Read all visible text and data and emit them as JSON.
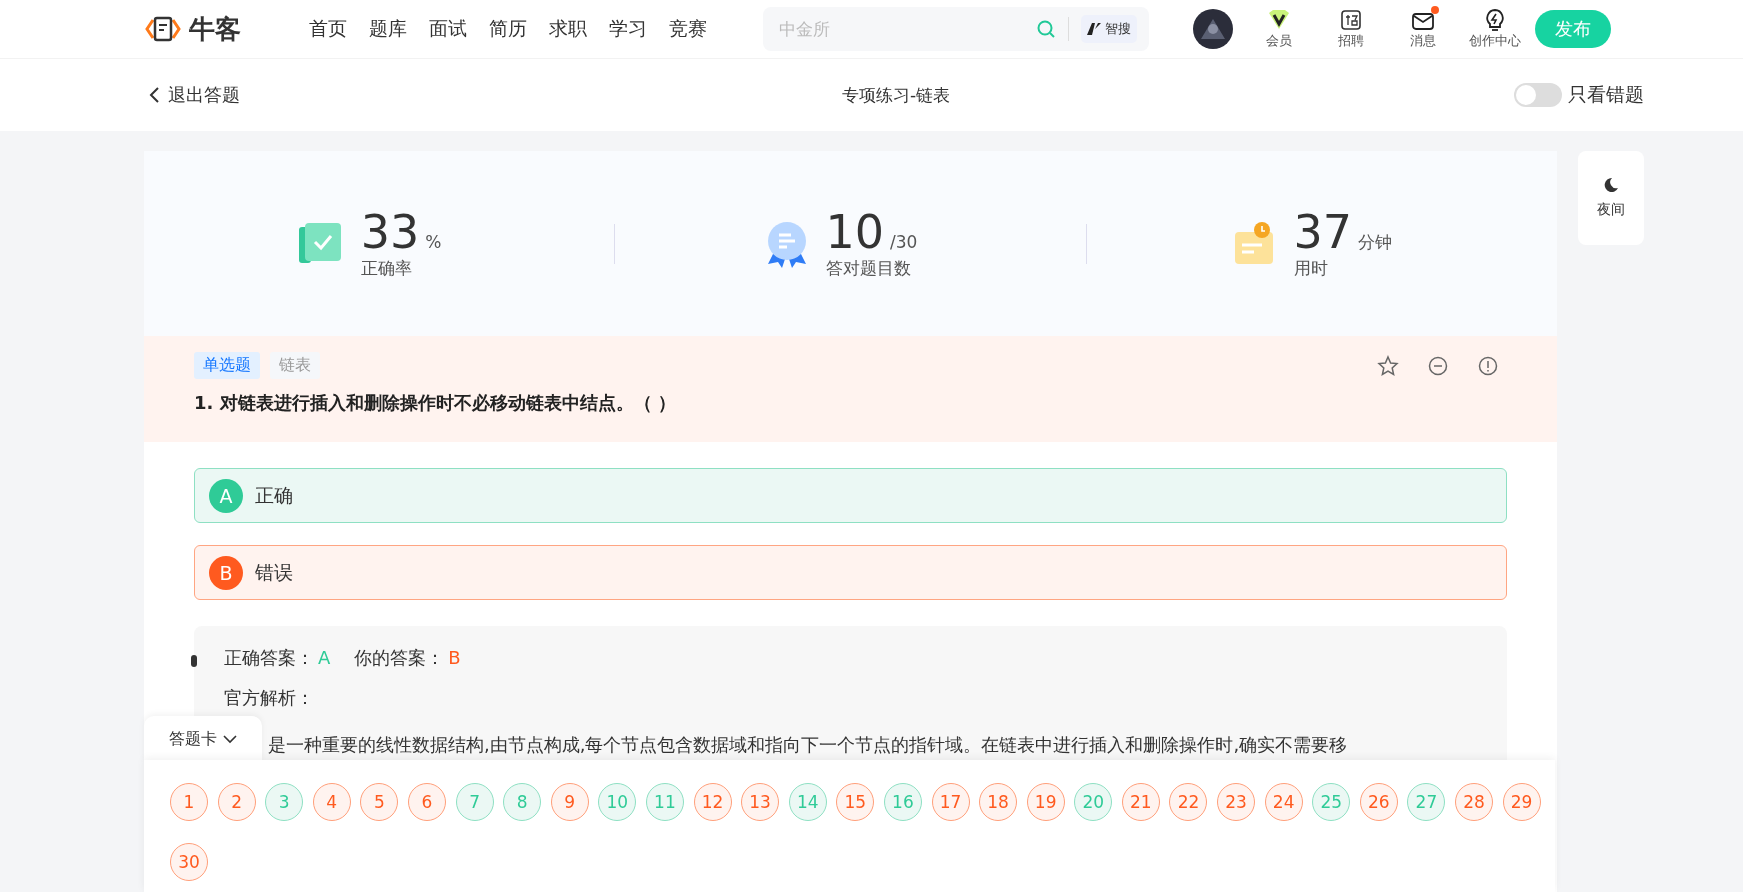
{
  "header": {
    "logo_text": "牛客",
    "nav": [
      "首页",
      "题库",
      "面试",
      "简历",
      "求职",
      "学习",
      "竞赛"
    ],
    "search": {
      "placeholder": "中金所",
      "ai_label": "智搜"
    },
    "shortcuts": [
      {
        "kind": "vip",
        "label": "会员",
        "badge": false
      },
      {
        "kind": "jobs",
        "label": "招聘",
        "badge": false
      },
      {
        "kind": "mail",
        "label": "消息",
        "badge": true
      },
      {
        "kind": "bulb",
        "label": "创作中心",
        "badge": false
      }
    ],
    "publish": "发布"
  },
  "subheader": {
    "back": "退出答题",
    "title": "专项练习-链表",
    "toggle": {
      "label": "只看错题",
      "on": false
    }
  },
  "stats": [
    {
      "kind": "accuracy",
      "value": "33",
      "unit": "%",
      "label": "正确率"
    },
    {
      "kind": "count",
      "value": "10",
      "unit": "/30",
      "label": "答对题目数"
    },
    {
      "kind": "time",
      "value": "37",
      "unit": "分钟",
      "label": "用时"
    }
  ],
  "night_mode": "夜间",
  "question": {
    "tags": [
      {
        "label": "单选题",
        "kind": "type"
      },
      {
        "label": "链表",
        "kind": "topic"
      }
    ],
    "text": "1. 对链表进行插入和删除操作时不必移动链表中结点。（  ）",
    "options": [
      {
        "letter": "A",
        "text": "正确",
        "is_answer": true,
        "selected": false
      },
      {
        "letter": "B",
        "text": "错误",
        "is_answer": false,
        "selected": true
      }
    ]
  },
  "analysis": {
    "correct_label": "正确答案：",
    "correct": "A",
    "yours_label": "你的答案：",
    "yours": "B",
    "heading": "官方解析：",
    "text": "是一种重要的线性数据结构,由节点构成,每个节点包含数据域和指向下一个节点的指针域。在链表中进行插入和删除操作时,确实不需要移"
  },
  "answer_card": {
    "title": "答题卡",
    "items": [
      {
        "n": "1",
        "correct": false
      },
      {
        "n": "2",
        "correct": false
      },
      {
        "n": "3",
        "correct": true
      },
      {
        "n": "4",
        "correct": false
      },
      {
        "n": "5",
        "correct": false
      },
      {
        "n": "6",
        "correct": false
      },
      {
        "n": "7",
        "correct": true
      },
      {
        "n": "8",
        "correct": true
      },
      {
        "n": "9",
        "correct": false
      },
      {
        "n": "10",
        "correct": true
      },
      {
        "n": "11",
        "correct": true
      },
      {
        "n": "12",
        "correct": false
      },
      {
        "n": "13",
        "correct": false
      },
      {
        "n": "14",
        "correct": true
      },
      {
        "n": "15",
        "correct": false
      },
      {
        "n": "16",
        "correct": true
      },
      {
        "n": "17",
        "correct": false
      },
      {
        "n": "18",
        "correct": false
      },
      {
        "n": "19",
        "correct": false
      },
      {
        "n": "20",
        "correct": true
      },
      {
        "n": "21",
        "correct": false
      },
      {
        "n": "22",
        "correct": false
      },
      {
        "n": "23",
        "correct": false
      },
      {
        "n": "24",
        "correct": false
      },
      {
        "n": "25",
        "correct": true
      },
      {
        "n": "26",
        "correct": false
      },
      {
        "n": "27",
        "correct": true
      },
      {
        "n": "28",
        "correct": false
      },
      {
        "n": "29",
        "correct": false
      },
      {
        "n": "30",
        "correct": false
      }
    ]
  }
}
